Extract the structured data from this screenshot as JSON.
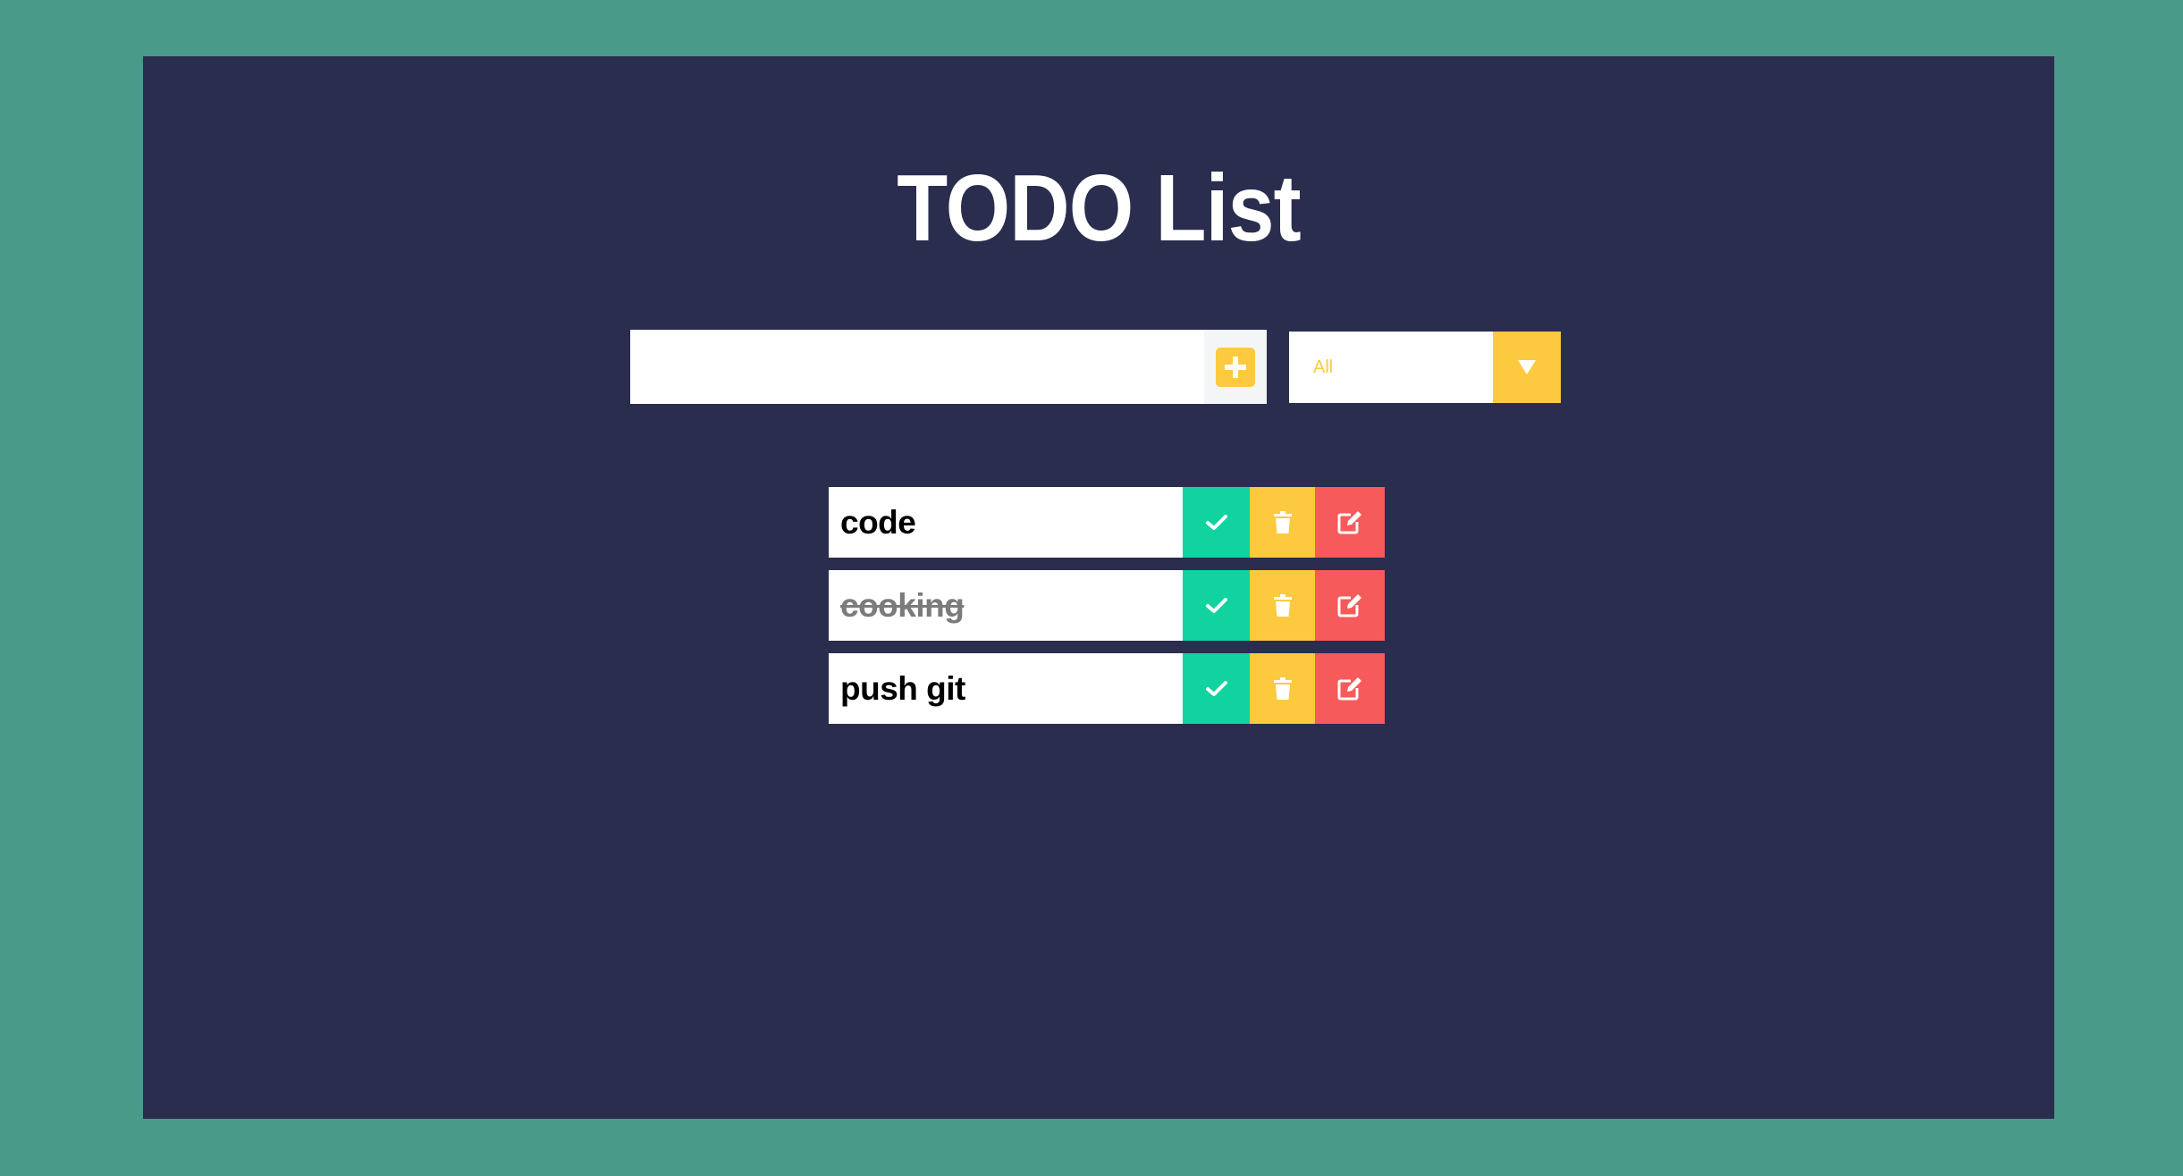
{
  "title": "TODO List",
  "form": {
    "input_value": "",
    "input_placeholder": "",
    "add_icon": "plus-square-icon"
  },
  "filter": {
    "selected": "All",
    "arrow_icon": "caret-down-icon"
  },
  "todos": [
    {
      "text": "code",
      "completed": false
    },
    {
      "text": "cooking",
      "completed": true
    },
    {
      "text": "push git",
      "completed": false
    }
  ],
  "actions": {
    "complete_icon": "check-icon",
    "delete_icon": "trash-icon",
    "edit_icon": "edit-icon"
  },
  "colors": {
    "page_background": "#4a9a8a",
    "panel_background": "#2b2d4e",
    "accent_yellow": "#fdc93f",
    "complete_green": "#10d3a0",
    "edit_red": "#f75a5a",
    "completed_text": "#7b7b7b"
  }
}
